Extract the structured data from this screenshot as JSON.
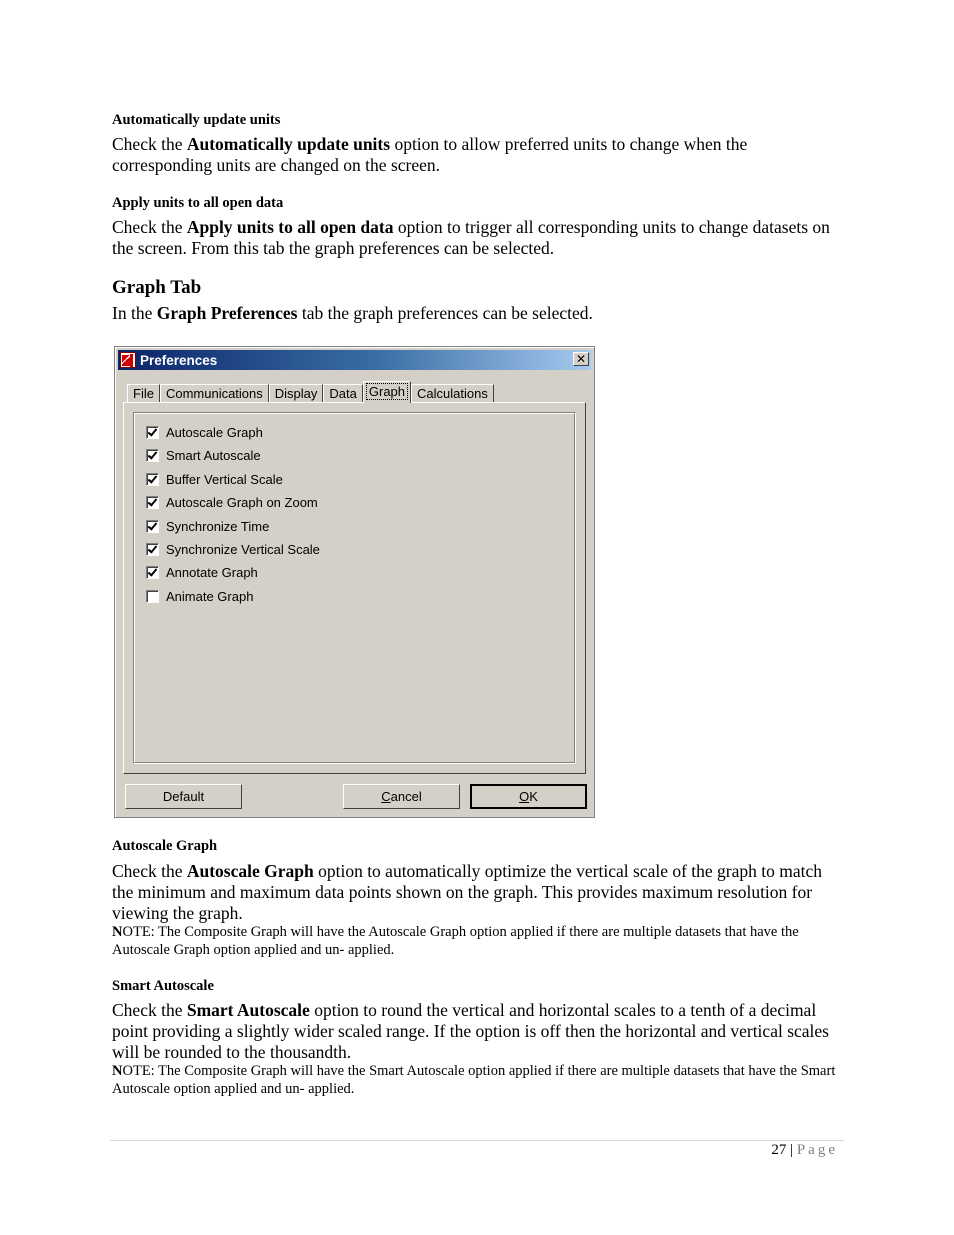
{
  "sections": {
    "auto_update": {
      "heading": "Automatically update units",
      "pre": "Check the ",
      "bold": "Automatically update units",
      "post": " option to allow preferred units to change when the corresponding units are changed on the screen."
    },
    "apply_units": {
      "heading": "Apply units to all open data",
      "pre": "Check the ",
      "bold": "Apply units to all open data",
      "post": " option to trigger all corresponding units to change datasets on the screen. From this tab the graph preferences can be selected."
    },
    "graph_tab": {
      "heading": "Graph Tab",
      "pre": "In the ",
      "bold": "Graph Preferences",
      "post": " tab the graph preferences can be selected."
    },
    "autoscale_graph": {
      "heading": "Autoscale Graph",
      "pre": "Check the ",
      "bold": "Autoscale Graph",
      "post": " option to automatically optimize the vertical scale of the graph to match the minimum and maximum data points shown on the graph. This provides maximum resolution for viewing the graph.",
      "note_n": "N",
      "note_rest": "OTE: The Composite Graph will have the Autoscale Graph option applied if there are multiple datasets that have the Autoscale Graph option applied and un- applied."
    },
    "smart_autoscale": {
      "heading": "Smart Autoscale",
      "pre": "Check the ",
      "bold": "Smart Autoscale",
      "post": " option to round the vertical and horizontal scales to a tenth of a decimal point providing a slightly wider scaled range. If the option is off then the horizontal and vertical scales will be rounded to the thousandth.",
      "note_n": "N",
      "note_rest": "OTE: The Composite Graph will have the Smart Autoscale option applied if there are multiple datasets that have the Smart Autoscale option applied and un- applied."
    }
  },
  "dialog": {
    "title": "Preferences",
    "close_glyph": "✕",
    "tabs": [
      {
        "label": "File"
      },
      {
        "label": "Communications"
      },
      {
        "label": "Display"
      },
      {
        "label": "Data"
      },
      {
        "label": "Graph",
        "active": true
      },
      {
        "label": "Calculations"
      }
    ],
    "options": [
      {
        "label": "Autoscale Graph",
        "checked": true
      },
      {
        "label": "Smart Autoscale",
        "checked": true
      },
      {
        "label": "Buffer Vertical Scale",
        "checked": true
      },
      {
        "label": "Autoscale Graph on Zoom",
        "checked": true
      },
      {
        "label": "Synchronize Time",
        "checked": true
      },
      {
        "label": "Synchronize Vertical Scale",
        "checked": true
      },
      {
        "label": "Annotate Graph",
        "checked": true
      },
      {
        "label": "Animate Graph",
        "checked": false
      }
    ],
    "buttons": {
      "default": "Default",
      "cancel_mnemonic": "C",
      "cancel_rest": "ancel",
      "ok_mnemonic": "O",
      "ok_rest": "K"
    }
  },
  "footer": {
    "page_number": "27",
    "separator": " | ",
    "page_label": "Page"
  }
}
